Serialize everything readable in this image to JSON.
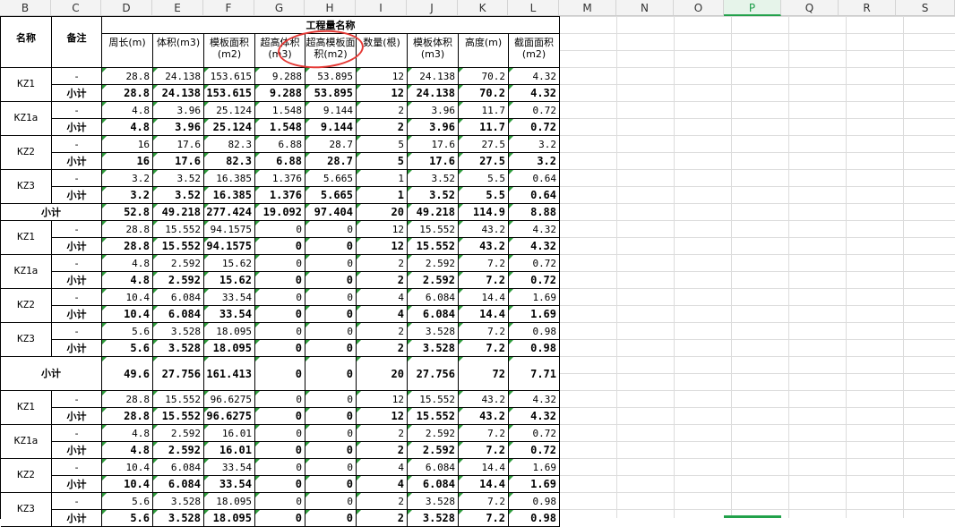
{
  "column_headers": [
    "B",
    "C",
    "D",
    "E",
    "F",
    "G",
    "H",
    "I",
    "J",
    "K",
    "L",
    "M",
    "N",
    "O",
    "P",
    "Q",
    "R",
    "S"
  ],
  "selected_column": "P",
  "header": {
    "name_col": "名称",
    "note_col": "备注",
    "group_title": "工程量名称",
    "cols": [
      "周长(m)",
      "体积(m3)",
      "模板面积(m2)",
      "超高体积(m3)",
      "超高模板面积(m2)",
      "数量(根)",
      "模板体积(m3)",
      "高度(m)",
      "截面面积(m2)"
    ]
  },
  "labels": {
    "dash": "-",
    "subtotal": "小计"
  },
  "groups": [
    {
      "items": [
        {
          "name": "KZ1",
          "values": [
            "28.8",
            "24.138",
            "153.615",
            "9.288",
            "53.895",
            "12",
            "24.138",
            "70.2",
            "4.32"
          ]
        },
        {
          "name": "KZ1a",
          "values": [
            "4.8",
            "3.96",
            "25.124",
            "1.548",
            "9.144",
            "2",
            "3.96",
            "11.7",
            "0.72"
          ]
        },
        {
          "name": "KZ2",
          "values": [
            "16",
            "17.6",
            "82.3",
            "6.88",
            "28.7",
            "5",
            "17.6",
            "27.5",
            "3.2"
          ]
        },
        {
          "name": "KZ3",
          "values": [
            "3.2",
            "3.52",
            "16.385",
            "1.376",
            "5.665",
            "1",
            "3.52",
            "5.5",
            "0.64"
          ]
        }
      ],
      "total": [
        "52.8",
        "49.218",
        "277.424",
        "19.092",
        "97.404",
        "20",
        "49.218",
        "114.9",
        "8.88"
      ]
    },
    {
      "items": [
        {
          "name": "KZ1",
          "values": [
            "28.8",
            "15.552",
            "94.1575",
            "0",
            "0",
            "12",
            "15.552",
            "43.2",
            "4.32"
          ]
        },
        {
          "name": "KZ1a",
          "values": [
            "4.8",
            "2.592",
            "15.62",
            "0",
            "0",
            "2",
            "2.592",
            "7.2",
            "0.72"
          ]
        },
        {
          "name": "KZ2",
          "values": [
            "10.4",
            "6.084",
            "33.54",
            "0",
            "0",
            "4",
            "6.084",
            "14.4",
            "1.69"
          ]
        },
        {
          "name": "KZ3",
          "values": [
            "5.6",
            "3.528",
            "18.095",
            "0",
            "0",
            "2",
            "3.528",
            "7.2",
            "0.98"
          ]
        }
      ],
      "total": [
        "49.6",
        "27.756",
        "161.413",
        "0",
        "0",
        "20",
        "27.756",
        "72",
        "7.71"
      ]
    },
    {
      "items": [
        {
          "name": "KZ1",
          "values": [
            "28.8",
            "15.552",
            "96.6275",
            "0",
            "0",
            "12",
            "15.552",
            "43.2",
            "4.32"
          ]
        },
        {
          "name": "KZ1a",
          "values": [
            "4.8",
            "2.592",
            "16.01",
            "0",
            "0",
            "2",
            "2.592",
            "7.2",
            "0.72"
          ]
        },
        {
          "name": "KZ2",
          "values": [
            "10.4",
            "6.084",
            "33.54",
            "0",
            "0",
            "4",
            "6.084",
            "14.4",
            "1.69"
          ]
        },
        {
          "name": "KZ3",
          "values": [
            "5.6",
            "3.528",
            "18.095",
            "0",
            "0",
            "2",
            "3.528",
            "7.2",
            "0.98"
          ]
        }
      ],
      "total": null
    }
  ]
}
